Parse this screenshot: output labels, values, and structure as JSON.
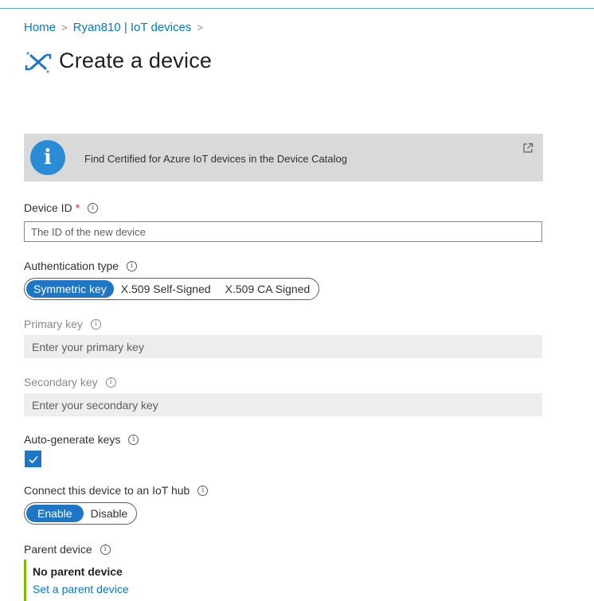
{
  "breadcrumb": {
    "items": [
      "Home",
      "Ryan810 | IoT devices"
    ],
    "separator": ">"
  },
  "page": {
    "title": "Create a device",
    "icon": "iot-device-icon"
  },
  "banner": {
    "icon": "info-icon",
    "text": "Find Certified for Azure IoT devices in the Device Catalog",
    "link_icon": "external-link-icon"
  },
  "form": {
    "device_id": {
      "label": "Device ID",
      "required_marker": "*",
      "placeholder": "The ID of the new device"
    },
    "auth_type": {
      "label": "Authentication type",
      "options": [
        "Symmetric key",
        "X.509 Self-Signed",
        "X.509 CA Signed"
      ],
      "selected": "Symmetric key"
    },
    "primary_key": {
      "label": "Primary key",
      "placeholder": "Enter your primary key"
    },
    "secondary_key": {
      "label": "Secondary key",
      "placeholder": "Enter your secondary key"
    },
    "auto_generate": {
      "label": "Auto-generate keys",
      "checked": true
    },
    "connect_hub": {
      "label": "Connect this device to an IoT hub",
      "options": [
        "Enable",
        "Disable"
      ],
      "selected": "Enable"
    },
    "parent_device": {
      "label": "Parent device",
      "value": "No parent device",
      "link": "Set a parent device"
    }
  },
  "colors": {
    "accent": "#1f76c4",
    "link": "#0078d4",
    "required": "#d13438",
    "parent_border": "#7fba00",
    "banner_bg": "#d9d9d9",
    "info_circle": "#2b8cd6"
  }
}
